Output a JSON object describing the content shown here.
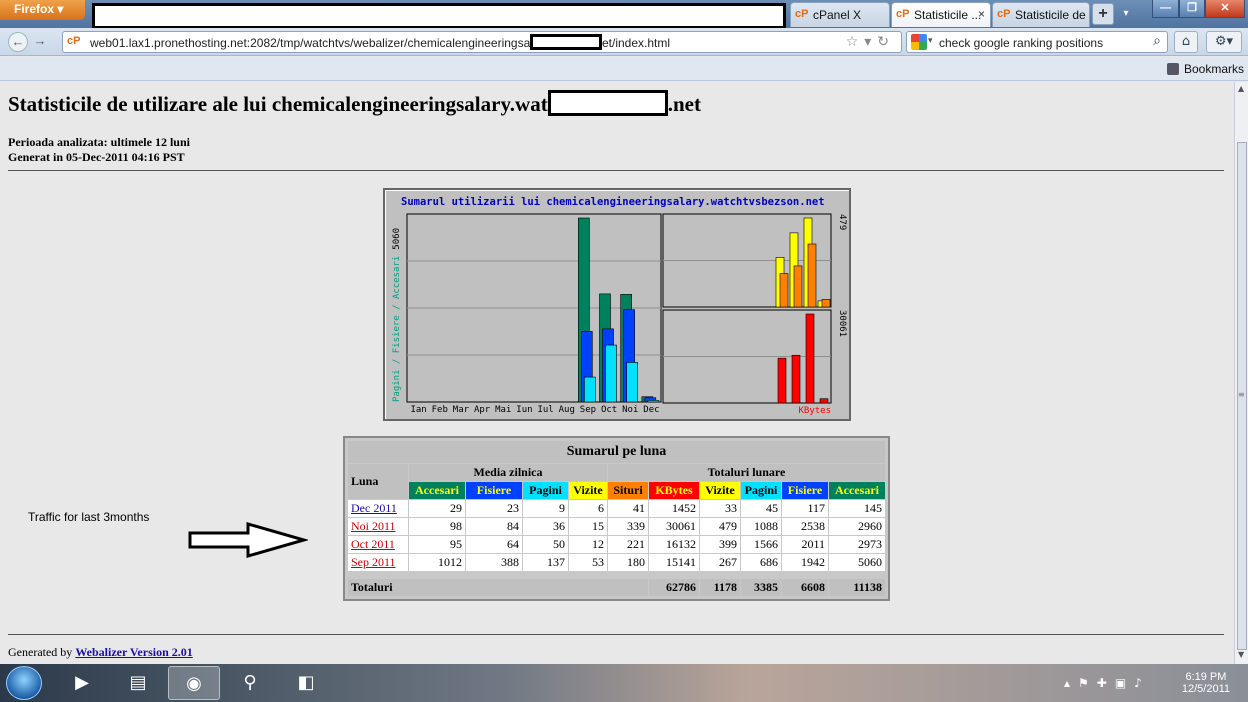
{
  "browser": {
    "menu_label": "Firefox ▾",
    "tabs": [
      {
        "icon": "cP",
        "label": "cPanel X"
      },
      {
        "icon": "cP",
        "label": "Statisticile ...",
        "close": "×"
      },
      {
        "icon": "cP",
        "label": "Statisticile de ..."
      }
    ],
    "newtab": "+",
    "tablist": "▾",
    "window_buttons": [
      "—",
      "❐",
      "✕"
    ],
    "url": "web01.lax1.pronethosting.net:2082/tmp/watchtvs/webalizer/chemicalengineeringsalary.wat",
    "url_suffix": "et/index.html",
    "search_text": "check google ranking positions",
    "bookmarks": "Bookmarks"
  },
  "page": {
    "title_pre": "Statisticile de utilizare ale lui chemicalengineeringsalary.wat",
    "title_post": ".net",
    "period": "Perioada analizata: ultimele 12 luni",
    "generated": "Generat in 05-Dec-2011 04:16 PST",
    "traffic_note": "Traffic for last 3months",
    "footer_prefix": "Generated by",
    "footer_link": "Webalizer Version 2.01"
  },
  "chart_data": {
    "type": "bar",
    "title": "Sumarul utilizarii lui chemicalengineeringsalary.watchtvsbezson.net",
    "categories": [
      "Ian",
      "Feb",
      "Mar",
      "Apr",
      "Mai",
      "Iun",
      "Iul",
      "Aug",
      "Sep",
      "Oct",
      "Noi",
      "Dec"
    ],
    "left_axis_label": "Pagini / Fisiere / Accesari",
    "left_axis_max_label": "5060",
    "right_top_label": "479",
    "right_bottom_label": "30061",
    "right_bottom_unit": "KBytes",
    "series": [
      {
        "name": "Accesari",
        "color": "#00805c",
        "values": [
          0,
          0,
          0,
          0,
          0,
          0,
          0,
          0,
          5060,
          2973,
          2960,
          145
        ]
      },
      {
        "name": "Fisiere",
        "color": "#0040ff",
        "values": [
          0,
          0,
          0,
          0,
          0,
          0,
          0,
          0,
          1942,
          2011,
          2538,
          117
        ]
      },
      {
        "name": "Pagini",
        "color": "#00e0ff",
        "values": [
          0,
          0,
          0,
          0,
          0,
          0,
          0,
          0,
          686,
          1566,
          1088,
          45
        ]
      },
      {
        "name": "Vizite",
        "color": "#ffff00",
        "values": [
          0,
          0,
          0,
          0,
          0,
          0,
          0,
          0,
          267,
          399,
          479,
          33
        ]
      },
      {
        "name": "Situri",
        "color": "#ff8000",
        "values": [
          0,
          0,
          0,
          0,
          0,
          0,
          0,
          0,
          180,
          221,
          339,
          41
        ]
      },
      {
        "name": "KBytes",
        "color": "#ff0000",
        "values": [
          0,
          0,
          0,
          0,
          0,
          0,
          0,
          0,
          15141,
          16132,
          30061,
          1452
        ]
      }
    ]
  },
  "summary": {
    "caption": "Sumarul pe luna",
    "col_month": "Luna",
    "group_daily": "Media zilnica",
    "group_totals": "Totaluri lunare",
    "daily_headers": [
      "Accesari",
      "Fisiere",
      "Pagini",
      "Vizite"
    ],
    "total_headers": [
      "Situri",
      "KBytes",
      "Vizite",
      "Pagini",
      "Fisiere",
      "Accesari"
    ],
    "rows": [
      {
        "month": "Dec 2011",
        "daily": [
          "29",
          "23",
          "9",
          "6"
        ],
        "totals": [
          "41",
          "1452",
          "33",
          "45",
          "117",
          "145"
        ]
      },
      {
        "month": "Noi 2011",
        "daily": [
          "98",
          "84",
          "36",
          "15"
        ],
        "totals": [
          "339",
          "30061",
          "479",
          "1088",
          "2538",
          "2960"
        ]
      },
      {
        "month": "Oct 2011",
        "daily": [
          "95",
          "64",
          "50",
          "12"
        ],
        "totals": [
          "221",
          "16132",
          "399",
          "1566",
          "2011",
          "2973"
        ]
      },
      {
        "month": "Sep 2011",
        "daily": [
          "1012",
          "388",
          "137",
          "53"
        ],
        "totals": [
          "180",
          "15141",
          "267",
          "686",
          "1942",
          "5060"
        ]
      }
    ],
    "totals_label": "Totaluri",
    "totals_row": [
      "62786",
      "1178",
      "3385",
      "6608",
      "11138"
    ]
  },
  "taskbar": {
    "time": "6:19 PM",
    "date": "12/5/2011"
  }
}
